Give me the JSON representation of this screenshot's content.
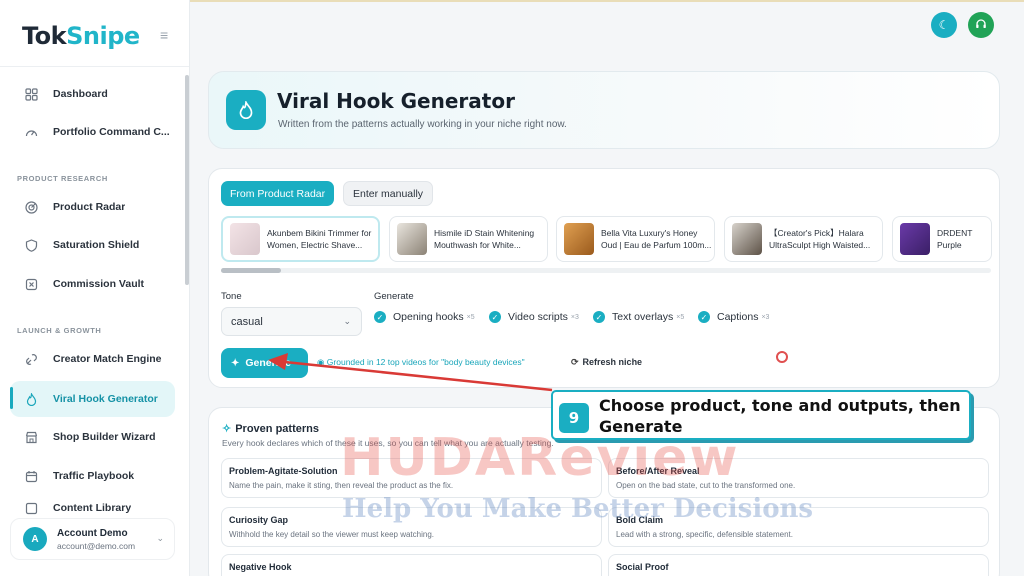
{
  "app": {
    "logo_part1": "Tok",
    "logo_part2": "Snipe"
  },
  "sidebar": {
    "items_top": [
      {
        "label": "Dashboard",
        "icon": "grid-icon"
      },
      {
        "label": "Portfolio Command C...",
        "icon": "gauge-icon"
      }
    ],
    "section_research": "PRODUCT RESEARCH",
    "items_research": [
      {
        "label": "Product Radar",
        "icon": "radar-icon"
      },
      {
        "label": "Saturation Shield",
        "icon": "shield-icon"
      },
      {
        "label": "Commission Vault",
        "icon": "vault-icon"
      }
    ],
    "section_launch": "LAUNCH & GROWTH",
    "items_launch": [
      {
        "label": "Creator Match Engine",
        "icon": "link-icon"
      },
      {
        "label": "Viral Hook Generator",
        "icon": "flame-icon",
        "active": true
      },
      {
        "label": "Shop Builder Wizard",
        "icon": "store-icon"
      },
      {
        "label": "Traffic Playbook",
        "icon": "calendar-icon"
      },
      {
        "label": "Content Library",
        "icon": "library-icon"
      }
    ],
    "account": {
      "initial": "A",
      "name": "Account Demo",
      "email": "account@demo.com"
    }
  },
  "hero": {
    "title": "Viral Hook Generator",
    "subtitle": "Written from the patterns actually working in your niche right now."
  },
  "generator": {
    "tabs": [
      "From Product Radar",
      "Enter manually"
    ],
    "products": [
      "Akunbem Bikini Trimmer for Women, Electric Shave...",
      "Hismile iD Stain Whitening Mouthwash for White...",
      "Bella Vita Luxury's Honey Oud | Eau de Parfum 100m...",
      "【Creator's Pick】Halara UltraSculpt High Waisted...",
      "DRDENT Purple Whitening Str..."
    ],
    "tone_label": "Tone",
    "tone_value": "casual",
    "generate_label": "Generate",
    "outputs": [
      {
        "label": "Opening hooks",
        "count": "×5"
      },
      {
        "label": "Video scripts",
        "count": "×3"
      },
      {
        "label": "Text overlays",
        "count": "×5"
      },
      {
        "label": "Captions",
        "count": "×3"
      }
    ],
    "generate_button": "Generate",
    "grounded_text": "Grounded in 12 top videos for \"body beauty devices\"",
    "refresh_label": "Refresh niche"
  },
  "patterns": {
    "title": "Proven patterns",
    "description": "Every hook declares which of these it uses, so you can tell what you are actually testing.",
    "items": [
      {
        "name": "Problem-Agitate-Solution",
        "text": "Name the pain, make it sting, then reveal the product as the fix."
      },
      {
        "name": "Before/After Reveal",
        "text": "Open on the bad state, cut to the transformed one."
      },
      {
        "name": "Curiosity Gap",
        "text": "Withhold the key detail so the viewer must keep watching."
      },
      {
        "name": "Bold Claim",
        "text": "Lead with a strong, specific, defensible statement."
      },
      {
        "name": "Negative Hook",
        "text": ""
      },
      {
        "name": "Social Proof",
        "text": ""
      }
    ]
  },
  "callout": {
    "number": "9",
    "text": "Choose product, tone and outputs, then Generate"
  },
  "watermark": {
    "line1": "HUDAReview",
    "line2": "Help You Make Better Decisions"
  },
  "colors": {
    "accent": "#1aaec2",
    "active_bg": "#e3f6f8",
    "arrow": "#d93a36"
  }
}
